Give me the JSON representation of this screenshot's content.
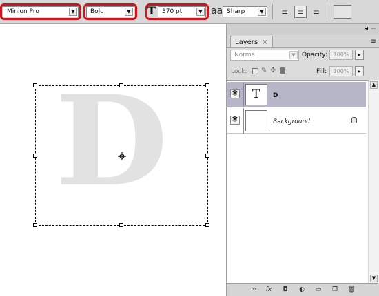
{
  "options_bar": {
    "font_family": "Minion Pro",
    "font_style": "Bold",
    "font_size": "370 pt",
    "antialias_label": "aa",
    "antialias_value": "Sharp"
  },
  "canvas": {
    "glyph": "D"
  },
  "layers_panel": {
    "tab_label": "Layers",
    "blend_mode": "Normal",
    "opacity_label": "Opacity:",
    "opacity_value": "100%",
    "lock_label": "Lock:",
    "fill_label": "Fill:",
    "fill_value": "100%",
    "layers": [
      {
        "name": "D",
        "thumb": "T"
      },
      {
        "name": "Background"
      }
    ]
  }
}
